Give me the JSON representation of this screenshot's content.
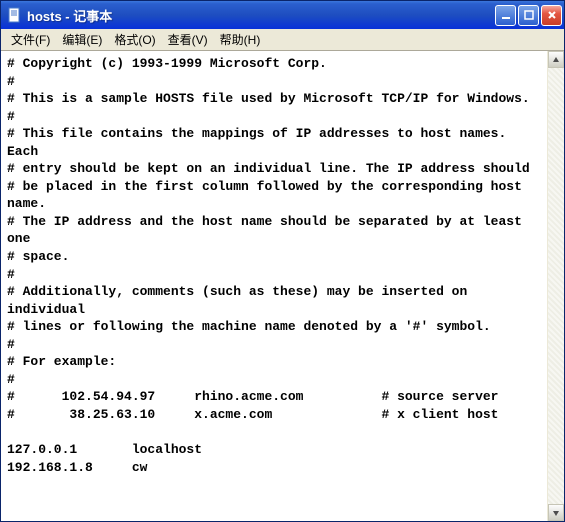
{
  "titlebar": {
    "title": "hosts - 记事本"
  },
  "menu": {
    "file": "文件(F)",
    "edit": "编辑(E)",
    "format": "格式(O)",
    "view": "查看(V)",
    "help": "帮助(H)"
  },
  "content": "# Copyright (c) 1993-1999 Microsoft Corp.\n#\n# This is a sample HOSTS file used by Microsoft TCP/IP for Windows.\n#\n# This file contains the mappings of IP addresses to host names. Each\n# entry should be kept on an individual line. The IP address should\n# be placed in the first column followed by the corresponding host name.\n# The IP address and the host name should be separated by at least one\n# space.\n#\n# Additionally, comments (such as these) may be inserted on individual\n# lines or following the machine name denoted by a '#' symbol.\n#\n# For example:\n#\n#      102.54.94.97     rhino.acme.com          # source server\n#       38.25.63.10     x.acme.com              # x client host\n\n127.0.0.1       localhost\n192.168.1.8     cw"
}
